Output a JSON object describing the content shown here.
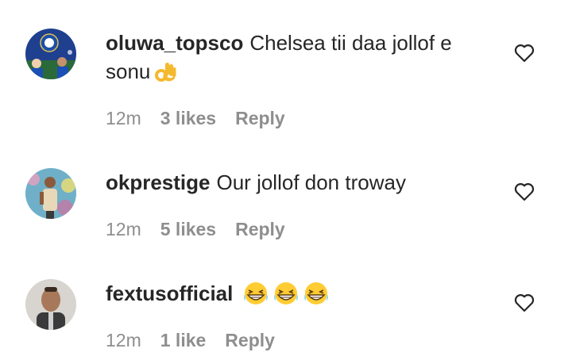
{
  "comments": [
    {
      "username": "oluwa_topsco",
      "text": "Chelsea tii daa jollof e sonu",
      "emoji": "ok-hand-emoji",
      "time": "12m",
      "likes": "3 likes",
      "reply_label": "Reply"
    },
    {
      "username": "okprestige",
      "text": "Our jollof don troway",
      "emoji": "",
      "time": "12m",
      "likes": "5 likes",
      "reply_label": "Reply"
    },
    {
      "username": "fextusofficial",
      "text": "",
      "emoji": "grinning-squinting-face-emoji x3",
      "time": "12m",
      "likes": "1 like",
      "reply_label": "Reply"
    }
  ],
  "colors": {
    "text": "#262626",
    "meta": "#8e8e8e",
    "emoji_yellow": "#ffcc33"
  }
}
